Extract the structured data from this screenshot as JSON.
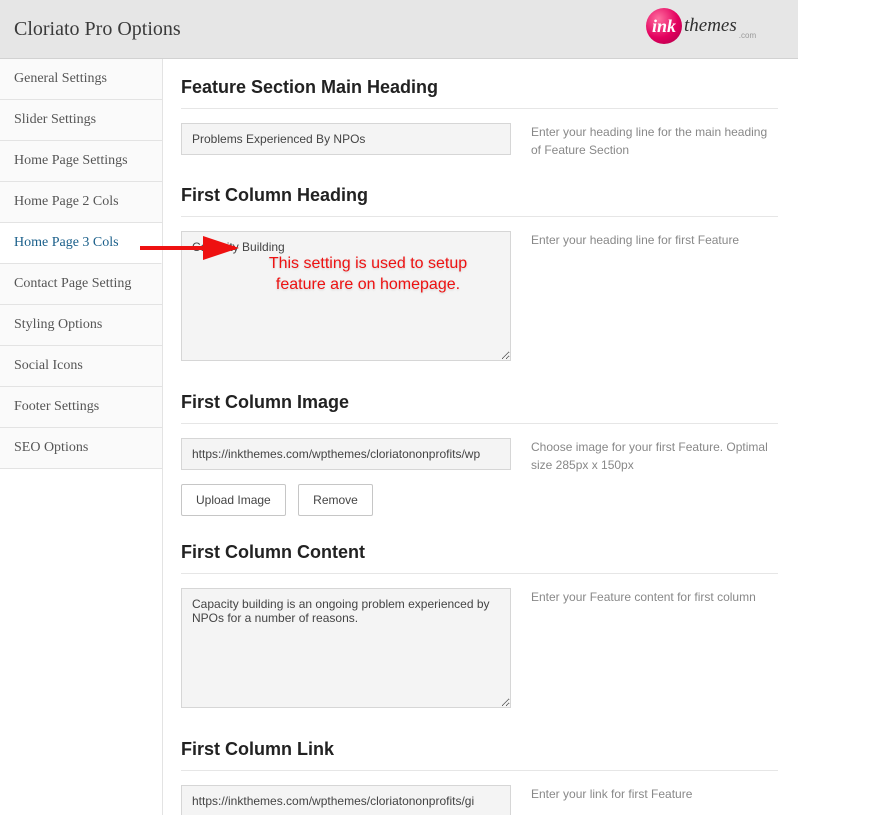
{
  "header": {
    "title": "Cloriato Pro Options",
    "logo_ball": "ink",
    "logo_text": "themes",
    "logo_sub": ".com"
  },
  "sidebar": {
    "items": [
      {
        "label": "General Settings"
      },
      {
        "label": "Slider Settings"
      },
      {
        "label": "Home Page Settings"
      },
      {
        "label": "Home Page 2 Cols"
      },
      {
        "label": "Home Page 3 Cols"
      },
      {
        "label": "Contact Page Setting"
      },
      {
        "label": "Styling Options"
      },
      {
        "label": "Social Icons"
      },
      {
        "label": "Footer Settings"
      },
      {
        "label": "SEO Options"
      }
    ],
    "active_index": 4
  },
  "sections": {
    "feature_heading": {
      "title": "Feature Section Main Heading",
      "value": "Problems Experienced By NPOs",
      "hint": "Enter your heading line for the main heading of Feature Section"
    },
    "col1_heading": {
      "title": "First Column Heading",
      "value": "Capacity Building",
      "hint": "Enter your heading line for first Feature"
    },
    "col1_image": {
      "title": "First Column Image",
      "value": "https://inkthemes.com/wpthemes/cloriatononprofits/wp",
      "hint": "Choose image for your first Feature. Optimal size 285px x 150px",
      "upload_label": "Upload Image",
      "remove_label": "Remove"
    },
    "col1_content": {
      "title": "First Column Content",
      "value": "Capacity building is an ongoing problem experienced by NPOs for a number of reasons.",
      "hint": "Enter your Feature content for first column"
    },
    "col1_link": {
      "title": "First Column Link",
      "value": "https://inkthemes.com/wpthemes/cloriatononprofits/gi",
      "hint": "Enter your link for first Feature"
    }
  },
  "annotation": {
    "line1": "This setting is used to setup",
    "line2": "feature are on homepage."
  }
}
